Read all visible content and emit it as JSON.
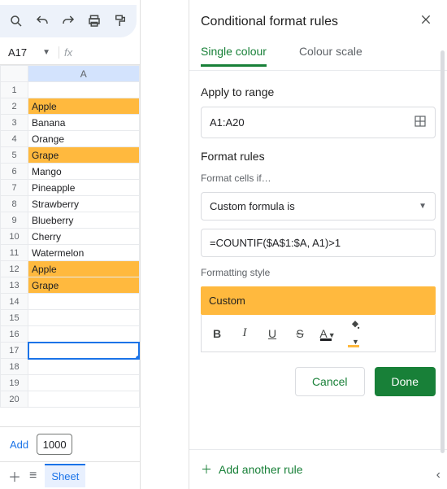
{
  "toolbar_icons": [
    "search",
    "undo",
    "redo",
    "print",
    "paint-format"
  ],
  "namebox": "A17",
  "fx": "fx",
  "col_header": "A",
  "rows": [
    {
      "n": 1,
      "val": "",
      "hl": false
    },
    {
      "n": 2,
      "val": "Apple",
      "hl": true
    },
    {
      "n": 3,
      "val": "Banana",
      "hl": false
    },
    {
      "n": 4,
      "val": "Orange",
      "hl": false
    },
    {
      "n": 5,
      "val": "Grape",
      "hl": true
    },
    {
      "n": 6,
      "val": "Mango",
      "hl": false
    },
    {
      "n": 7,
      "val": "Pineapple",
      "hl": false
    },
    {
      "n": 8,
      "val": "Strawberry",
      "hl": false
    },
    {
      "n": 9,
      "val": "Blueberry",
      "hl": false
    },
    {
      "n": 10,
      "val": "Cherry",
      "hl": false
    },
    {
      "n": 11,
      "val": "Watermelon",
      "hl": false
    },
    {
      "n": 12,
      "val": "Apple",
      "hl": true
    },
    {
      "n": 13,
      "val": "Grape",
      "hl": true
    },
    {
      "n": 14,
      "val": "",
      "hl": false
    },
    {
      "n": 15,
      "val": "",
      "hl": false
    },
    {
      "n": 16,
      "val": "",
      "hl": false
    },
    {
      "n": 17,
      "val": "",
      "hl": false,
      "selected": true
    },
    {
      "n": 18,
      "val": "",
      "hl": false
    },
    {
      "n": 19,
      "val": "",
      "hl": false
    },
    {
      "n": 20,
      "val": "",
      "hl": false
    }
  ],
  "addrow": {
    "label": "Add",
    "count": "1000"
  },
  "sheet_tab": "Sheet",
  "panel": {
    "title": "Conditional format rules",
    "tabs": {
      "single": "Single colour",
      "scale": "Colour scale"
    },
    "apply_label": "Apply to range",
    "range": "A1:A20",
    "rules_label": "Format rules",
    "cells_if": "Format cells if…",
    "condition": "Custom formula is",
    "formula": "=COUNTIF($A$1:$A, A1)>1",
    "style_label": "Formatting style",
    "style_preview": "Custom",
    "style_buttons": {
      "bold": "B",
      "italic": "I",
      "underline": "U",
      "strike": "S",
      "text": "A"
    },
    "cancel": "Cancel",
    "done": "Done",
    "add_rule": "Add another rule"
  }
}
